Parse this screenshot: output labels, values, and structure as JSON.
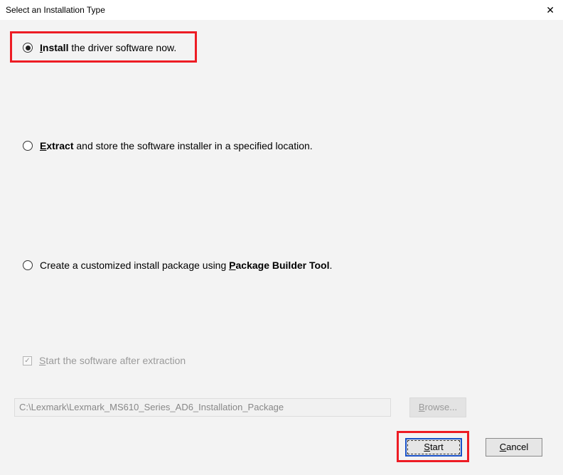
{
  "titlebar": {
    "title": "Select an Installation Type"
  },
  "options": {
    "install": {
      "prefix": "I",
      "bold": "nstall",
      "rest": " the driver software now."
    },
    "extract": {
      "prefix": "E",
      "bold": "xtract",
      "rest": " and store the software installer in a specified location."
    },
    "package": {
      "prefix": "Create a customized install package using ",
      "p_mnemonic": "P",
      "bold": "ackage Builder Tool",
      "rest": "."
    }
  },
  "checkbox": {
    "label_prefix": "S",
    "label_rest": "tart the software after extraction"
  },
  "path": "C:\\Lexmark\\Lexmark_MS610_Series_AD6_Installation_Package",
  "buttons": {
    "browse_prefix": "B",
    "browse_rest": "rowse...",
    "start_prefix": "S",
    "start_rest": "tart",
    "cancel_prefix": "C",
    "cancel_rest": "ancel"
  }
}
